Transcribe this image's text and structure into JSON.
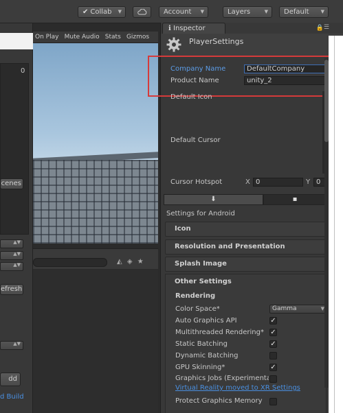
{
  "toolbar": {
    "collab_label": "Collab",
    "account_label": "Account",
    "layers_label": "Layers",
    "layout_label": "Default"
  },
  "left_panel": {
    "zero_value": "0",
    "scenes_button": "cenes",
    "refresh_button": "efresh",
    "add_button": "dd",
    "build_link": "d Build"
  },
  "game_view": {
    "toolbar_items": [
      "On Play",
      "Mute Audio",
      "Stats",
      "Gizmos"
    ]
  },
  "inspector": {
    "tab_label": "Inspector",
    "title": "PlayerSettings",
    "company_name_label": "Company Name",
    "company_name_value": "DefaultCompany",
    "product_name_label": "Product Name",
    "product_name_value": "unity_2",
    "default_icon_label": "Default Icon",
    "default_cursor_label": "Default Cursor",
    "cursor_hotspot_label": "Cursor Hotspot",
    "cursor_x_label": "X",
    "cursor_x_value": "0",
    "cursor_y_label": "Y",
    "cursor_y_value": "0",
    "settings_for": "Settings for Android",
    "sections": {
      "icon": "Icon",
      "resolution": "Resolution and Presentation",
      "splash": "Splash Image",
      "other": "Other Settings"
    },
    "rendering": {
      "title": "Rendering",
      "color_space_label": "Color Space*",
      "color_space_value": "Gamma",
      "auto_graphics_label": "Auto Graphics API",
      "multithreaded_label": "Multithreaded Rendering*",
      "static_batching_label": "Static Batching",
      "dynamic_batching_label": "Dynamic Batching",
      "gpu_skinning_label": "GPU Skinning*",
      "graphics_jobs_label": "Graphics Jobs (Experimental)",
      "vr_link": "Virtual Reality moved to XR Settings",
      "protect_memory_label": "Protect Graphics Memory"
    },
    "checkboxes": {
      "auto_graphics": true,
      "multithreaded": true,
      "static_batching": true,
      "dynamic_batching": false,
      "gpu_skinning": true,
      "graphics_jobs": false,
      "protect_memory": false
    }
  }
}
